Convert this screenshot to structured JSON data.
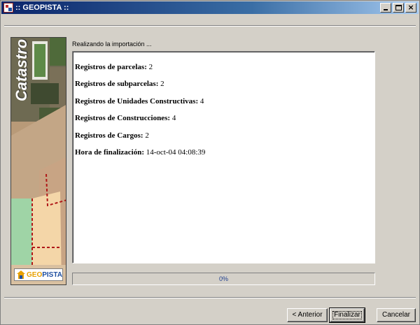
{
  "window": {
    "title": ":: GEOPISTA ::"
  },
  "titlebar_buttons": {
    "minimize_icon": "minimize-icon",
    "maximize_icon": "maximize-icon",
    "close_label": "×"
  },
  "side_panel": {
    "label": "Catastro",
    "logo": {
      "geo": "GEO",
      "pista": "PISTA"
    }
  },
  "status": "Realizando la importación ...",
  "results": [
    {
      "label": "Registros de parcelas:",
      "value": "2"
    },
    {
      "label": "Registros de subparcelas:",
      "value": "2"
    },
    {
      "label": "Registros de Unidades Constructivas:",
      "value": "4"
    },
    {
      "label": "Registros de Construcciones:",
      "value": "4"
    },
    {
      "label": "Registros de Cargos:",
      "value": "2"
    },
    {
      "label": "Hora de finalización:",
      "value": "14-oct-04 04:08:39"
    }
  ],
  "progress": {
    "percent": 0,
    "text": "0%"
  },
  "buttons": {
    "previous": "< Anterior",
    "finish": "Finalizar",
    "cancel": "Cancelar"
  },
  "colors": {
    "titlebar_start": "#0a246a",
    "titlebar_end": "#a6caf0",
    "window_bg": "#d4d0c8",
    "progress_text": "#1f3f8f",
    "logo_geo": "#e8a000",
    "logo_pista": "#1f4fa0"
  }
}
